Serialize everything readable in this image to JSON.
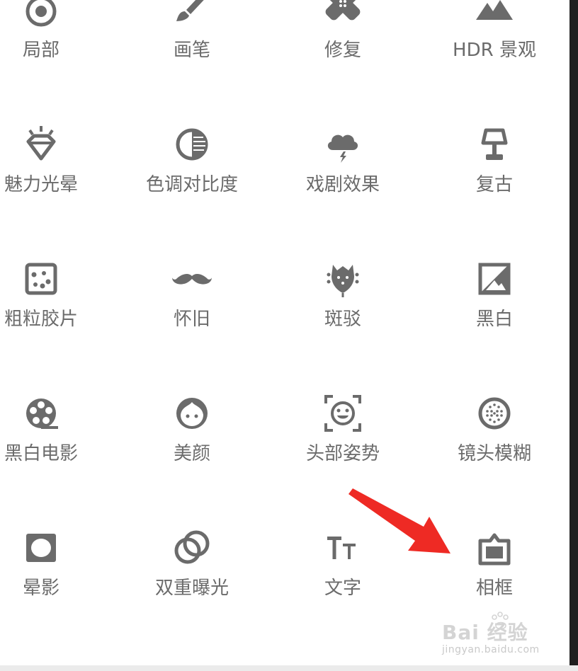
{
  "tools": [
    {
      "label": "局部",
      "icon": "local-adjust-icon"
    },
    {
      "label": "画笔",
      "icon": "brush-icon"
    },
    {
      "label": "修复",
      "icon": "healing-icon"
    },
    {
      "label": "HDR 景观",
      "icon": "hdr-landscape-icon"
    },
    {
      "label": "魅力光晕",
      "icon": "glamour-glow-icon"
    },
    {
      "label": "色调对比度",
      "icon": "tonal-contrast-icon"
    },
    {
      "label": "戏剧效果",
      "icon": "drama-icon"
    },
    {
      "label": "复古",
      "icon": "vintage-lamp-icon"
    },
    {
      "label": "粗粒胶片",
      "icon": "grainy-film-icon"
    },
    {
      "label": "怀旧",
      "icon": "retrolux-mustache-icon"
    },
    {
      "label": "斑驳",
      "icon": "grunge-icon"
    },
    {
      "label": "黑白",
      "icon": "black-white-icon"
    },
    {
      "label": "黑白电影",
      "icon": "noir-film-reel-icon"
    },
    {
      "label": "美颜",
      "icon": "portrait-face-icon"
    },
    {
      "label": "头部姿势",
      "icon": "head-pose-icon"
    },
    {
      "label": "镜头模糊",
      "icon": "lens-blur-icon"
    },
    {
      "label": "晕影",
      "icon": "vignette-icon"
    },
    {
      "label": "双重曝光",
      "icon": "double-exposure-icon"
    },
    {
      "label": "文字",
      "icon": "text-icon"
    },
    {
      "label": "相框",
      "icon": "frames-icon"
    }
  ],
  "colors": {
    "icon": "#6b6b6b",
    "label": "#6b6b6b",
    "arrow": "#ee2a24",
    "watermark": "#d0d0d0"
  },
  "watermark": {
    "brand": "Bai 经验",
    "url": "jingyan.baidu.com"
  }
}
